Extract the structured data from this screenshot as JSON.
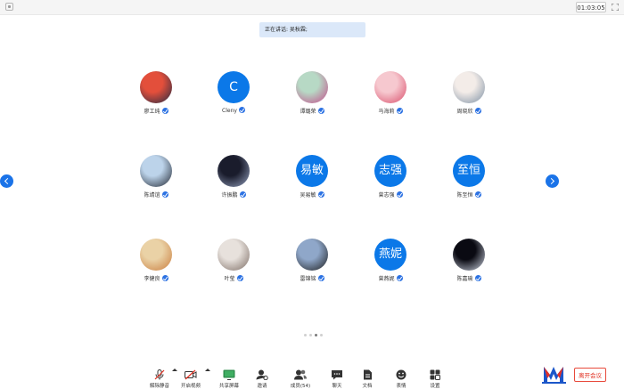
{
  "topbar": {
    "timer": "01:03:05",
    "icons": [
      "shield-icon",
      "fullscreen-icon"
    ]
  },
  "speaking": {
    "text": "正在讲话: 吴秋霖;"
  },
  "participants": [
    {
      "name": "廖工纯",
      "avatar": "photo",
      "colors": [
        "#e34f3b",
        "#1f2a44"
      ]
    },
    {
      "name": "Cleny",
      "avatar": "initials",
      "initials": "C"
    },
    {
      "name": "谭璐荣",
      "avatar": "photo",
      "colors": [
        "#b7d9c5",
        "#c34a8a"
      ]
    },
    {
      "name": "马海莉",
      "avatar": "photo",
      "colors": [
        "#f6c8cf",
        "#d94d6a"
      ]
    },
    {
      "name": "周晓欣",
      "avatar": "photo",
      "colors": [
        "#f3ece8",
        "#7c8fa3"
      ]
    },
    {
      "name": "陈靖谊",
      "avatar": "photo",
      "colors": [
        "#bcd3ea",
        "#1f2530"
      ]
    },
    {
      "name": "许振鹏",
      "avatar": "photo",
      "colors": [
        "#1a1c2c",
        "#95a2c0"
      ]
    },
    {
      "name": "吴易敏",
      "avatar": "initials",
      "initials": "易敏"
    },
    {
      "name": "曾志强",
      "avatar": "initials",
      "initials": "志强"
    },
    {
      "name": "陈至恒",
      "avatar": "initials",
      "initials": "至恒"
    },
    {
      "name": "李健良",
      "avatar": "photo",
      "colors": [
        "#ead2a6",
        "#c97b3b"
      ]
    },
    {
      "name": "叶莹",
      "avatar": "photo",
      "colors": [
        "#e7e1dc",
        "#7a6a62"
      ]
    },
    {
      "name": "雷锦铭",
      "avatar": "photo",
      "colors": [
        "#8fa7c9",
        "#1b1b1b"
      ]
    },
    {
      "name": "曾燕妮",
      "avatar": "initials",
      "initials": "燕妮"
    },
    {
      "name": "陈嘉瑜",
      "avatar": "photo",
      "colors": [
        "#0a0a12",
        "#cfd6e4"
      ]
    }
  ],
  "pager": {
    "pages": 4,
    "current": 3
  },
  "toolbar": [
    {
      "label": "解除静音",
      "icon": "mic-muted-icon"
    },
    {
      "label": "开启视频",
      "icon": "camera-off-icon"
    },
    {
      "label": "共享屏幕",
      "icon": "share-screen-icon"
    },
    {
      "label": "邀请",
      "icon": "invite-icon"
    },
    {
      "label": "成员(54)",
      "icon": "members-icon"
    },
    {
      "label": "聊天",
      "icon": "chat-icon"
    },
    {
      "label": "文档",
      "icon": "document-icon"
    },
    {
      "label": "表情",
      "icon": "emoji-icon"
    },
    {
      "label": "设置",
      "icon": "settings-icon"
    }
  ],
  "leave": {
    "label": "离开会议"
  },
  "colors": {
    "accent": "#0b78e8",
    "danger": "#e02e1f"
  }
}
